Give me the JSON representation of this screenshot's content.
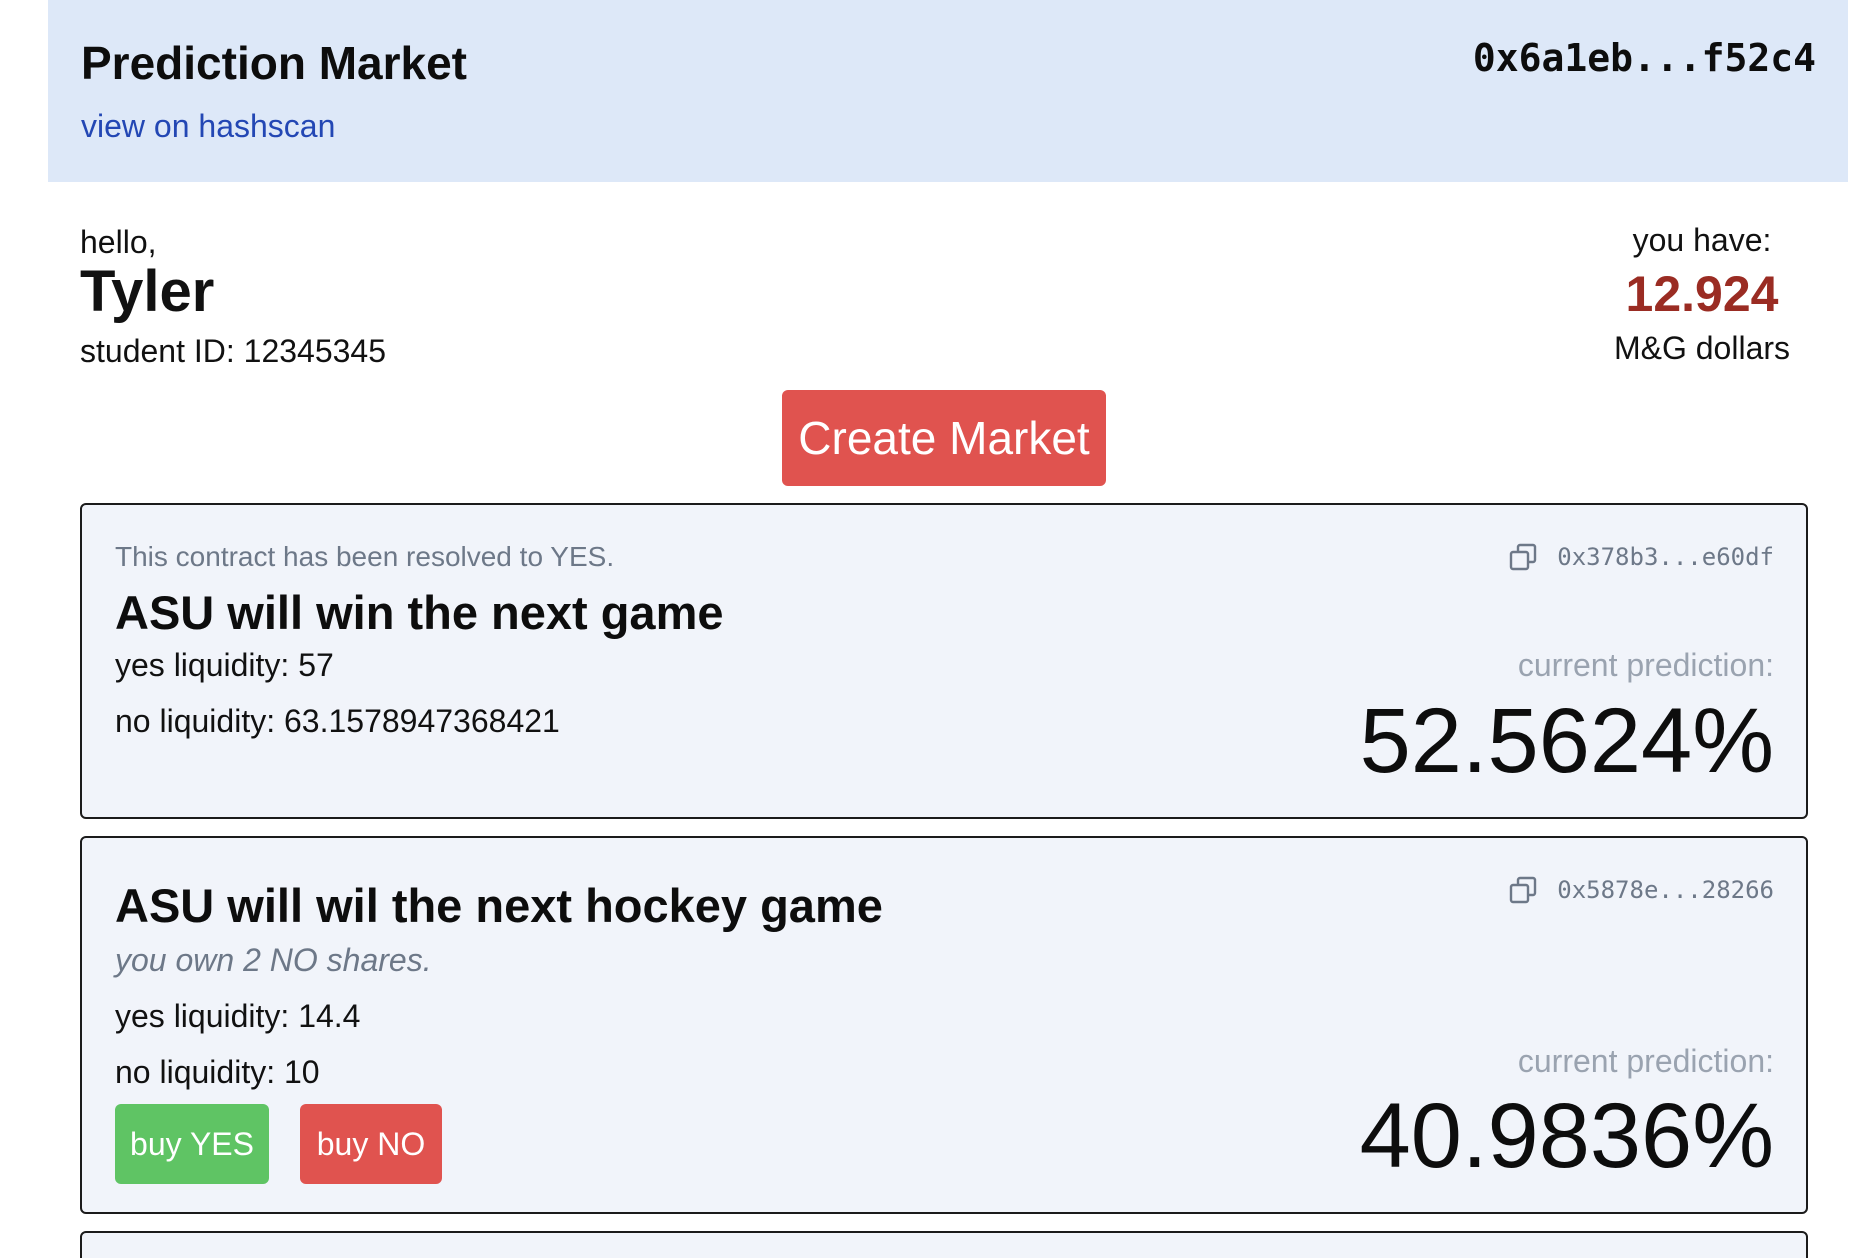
{
  "header": {
    "title": "Prediction Market",
    "link_label": "view on hashscan",
    "wallet_address": "0x6a1eb...f52c4"
  },
  "user": {
    "greeting": "hello,",
    "name": "Tyler",
    "student_id_label": "student ID: 12345345"
  },
  "balance": {
    "label": "you have:",
    "amount": "12.924",
    "unit": "M&G dollars",
    "amount_color": "#9a2c23"
  },
  "actions": {
    "create_market_label": "Create Market"
  },
  "markets": [
    {
      "status_note": "This contract has been resolved to YES.",
      "title": "ASU will win the next game",
      "yes_liquidity": "yes liquidity: 57",
      "no_liquidity": "no liquidity: 63.1578947368421",
      "address": "0x378b3...e60df",
      "prediction_label": "current prediction:",
      "prediction_value": "52.5624%",
      "copy_icon": "copy-icon"
    },
    {
      "owned_note": "you own 2 NO shares.",
      "title": "ASU will wil the next hockey game",
      "yes_liquidity": "yes liquidity: 14.4",
      "no_liquidity": "no liquidity: 10",
      "address": "0x5878e...28266",
      "prediction_label": "current prediction:",
      "prediction_value": "40.9836%",
      "buy_yes_label": "buy YES",
      "buy_no_label": "buy NO",
      "copy_icon": "copy-icon"
    }
  ],
  "colors": {
    "header_bg": "#dde8f8",
    "card_bg": "#f1f4fa",
    "danger": "#e0534f",
    "success": "#5fc464",
    "link": "#2347b4"
  }
}
